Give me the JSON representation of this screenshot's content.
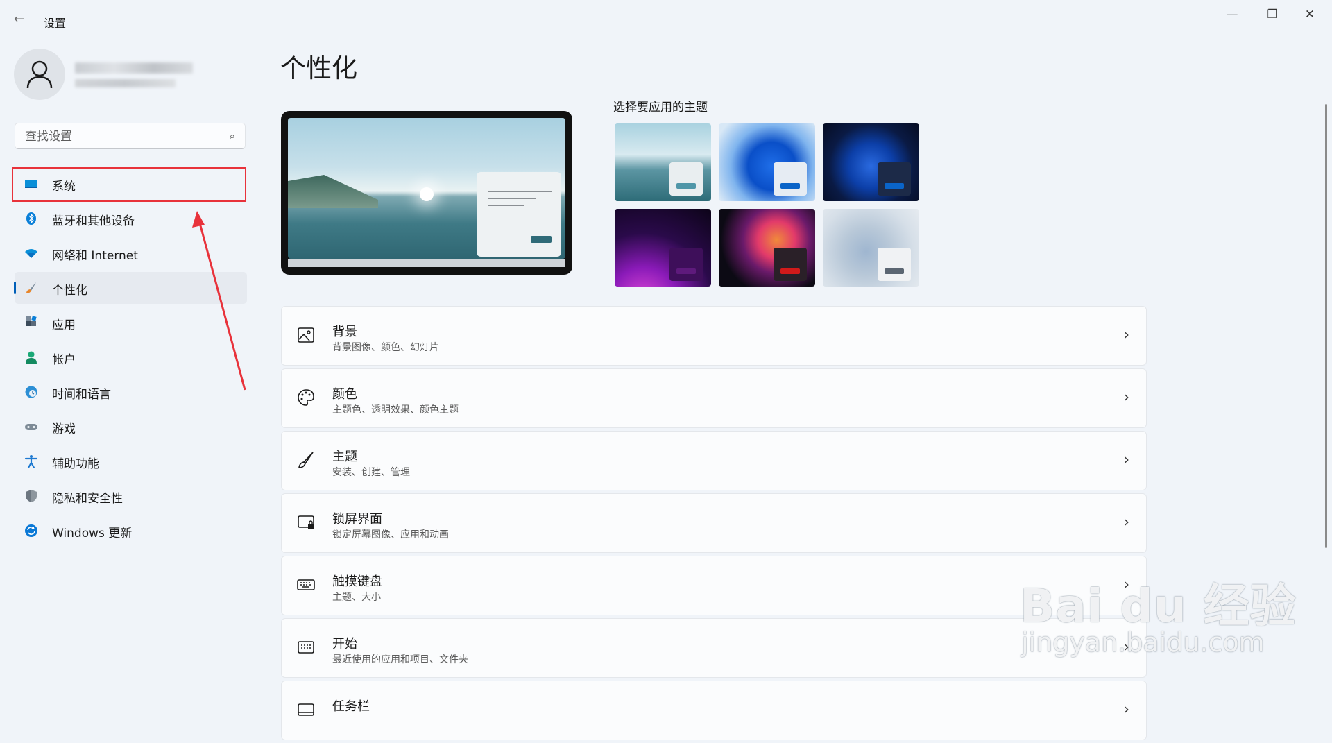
{
  "window": {
    "title": "设置",
    "back_icon": "arrow-left-icon",
    "controls": {
      "minimize": "—",
      "maximize": "❐",
      "close": "✕"
    }
  },
  "sidebar": {
    "search_placeholder": "查找设置",
    "items": [
      {
        "label": "系统",
        "icon": "monitor-icon",
        "color": "#0078d4"
      },
      {
        "label": "蓝牙和其他设备",
        "icon": "bluetooth-icon",
        "color": "#0078d4"
      },
      {
        "label": "网络和 Internet",
        "icon": "wifi-icon",
        "color": "#0078d4"
      },
      {
        "label": "个性化",
        "icon": "brush-icon",
        "color": "#e8862a",
        "active": true
      },
      {
        "label": "应用",
        "icon": "apps-icon",
        "color": "#3b4a5a"
      },
      {
        "label": "帐户",
        "icon": "account-icon",
        "color": "#1aa876"
      },
      {
        "label": "时间和语言",
        "icon": "clock-globe-icon",
        "color": "#2d8fd5"
      },
      {
        "label": "游戏",
        "icon": "gamepad-icon",
        "color": "#7d8a96"
      },
      {
        "label": "辅助功能",
        "icon": "accessibility-icon",
        "color": "#1f7ad1"
      },
      {
        "label": "隐私和安全性",
        "icon": "shield-icon",
        "color": "#6c7680"
      },
      {
        "label": "Windows 更新",
        "icon": "update-icon",
        "color": "#0a78d6"
      }
    ]
  },
  "main": {
    "title": "个性化",
    "themes_label": "选择要应用的主题",
    "themes": [
      {
        "name": "lake",
        "chip": "#4f96a8"
      },
      {
        "name": "bloom-light",
        "chip": "#0a64c8"
      },
      {
        "name": "bloom-dark",
        "chip": "#0a64c8"
      },
      {
        "name": "glow",
        "chip": "#5e1a7c"
      },
      {
        "name": "flow",
        "chip": "#d11a1a"
      },
      {
        "name": "sculpture",
        "chip": "#5b6672"
      }
    ],
    "rows": [
      {
        "title": "背景",
        "subtitle": "背景图像、颜色、幻灯片",
        "icon": "image-icon"
      },
      {
        "title": "颜色",
        "subtitle": "主题色、透明效果、颜色主题",
        "icon": "palette-icon"
      },
      {
        "title": "主题",
        "subtitle": "安装、创建、管理",
        "icon": "brush-icon"
      },
      {
        "title": "锁屏界面",
        "subtitle": "锁定屏幕图像、应用和动画",
        "icon": "lock-screen-icon"
      },
      {
        "title": "触摸键盘",
        "subtitle": "主题、大小",
        "icon": "keyboard-icon"
      },
      {
        "title": "开始",
        "subtitle": "最近使用的应用和项目、文件夹",
        "icon": "start-icon"
      },
      {
        "title": "任务栏",
        "subtitle": "",
        "icon": "taskbar-icon"
      }
    ]
  },
  "watermark": {
    "main": "Bai du 经验",
    "sub": "jingyan.baidu.com"
  }
}
